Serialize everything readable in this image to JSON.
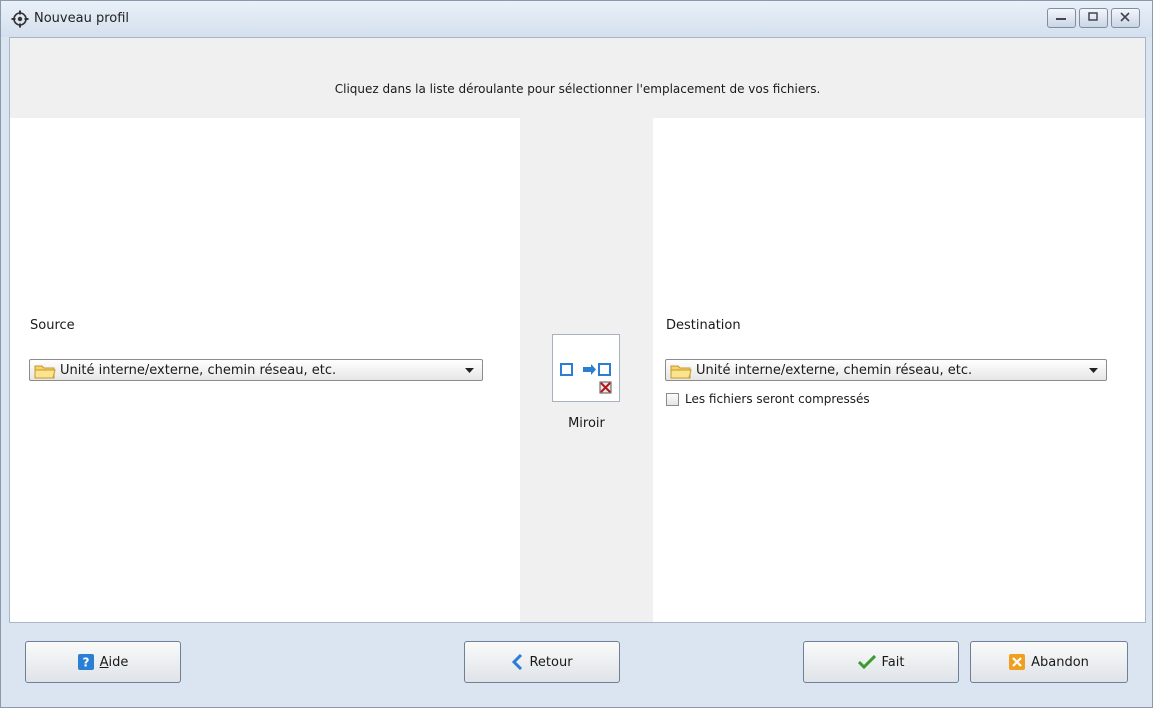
{
  "window": {
    "title": "Nouveau profil",
    "title_icon": "app-gear-icon",
    "controls": [
      "minimize-icon",
      "maximize-icon",
      "close-icon"
    ]
  },
  "banner": {
    "instruction": "Cliquez dans la liste déroulante pour sélectionner l'emplacement de vos fichiers."
  },
  "source": {
    "label": "Source",
    "combo_value": "Unité interne/externe, chemin réseau, etc.",
    "icon": "folder-icon"
  },
  "mirror": {
    "label": "Miroir",
    "icon": "mirror-sync-icon"
  },
  "destination": {
    "label": "Destination",
    "combo_value": "Unité interne/externe, chemin réseau, etc.",
    "icon": "folder-icon",
    "compress_label": "Les fichiers seront compressés",
    "compress_checked": false
  },
  "footer": {
    "help_accel": "A",
    "help_rest": "ide",
    "back_label": "Retour",
    "done_label": "Fait",
    "cancel_label": "Abandon"
  },
  "colors": {
    "frame": "#dbe5f1",
    "panel_gray": "#f0f0f0",
    "accent_blue": "#2a7fd4",
    "done_green": "#3c9a2e",
    "cancel_orange": "#f0a020"
  }
}
